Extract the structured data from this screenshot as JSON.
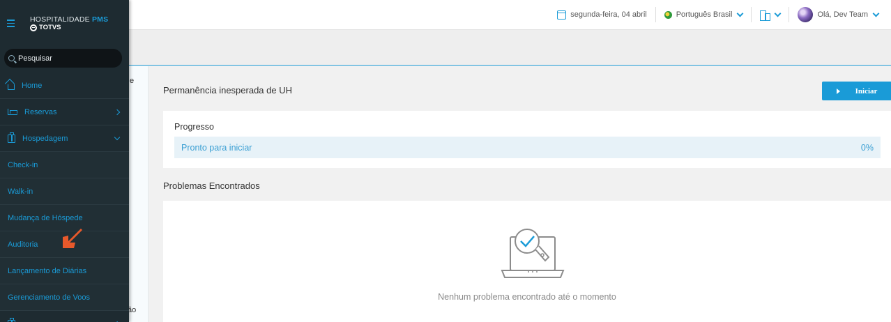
{
  "topbar": {
    "date": "segunda-feira, 04 abril",
    "language": "Português Brasil",
    "greeting": "Olá, Dev Team"
  },
  "sidebar": {
    "brand_top": "HOSPITALIDADE",
    "brand_accent": "PMS",
    "brand_bottom": "TOTVS",
    "search_placeholder": "Pesquisar",
    "items": [
      {
        "label": "Home",
        "icon": "home-icon"
      },
      {
        "label": "Reservas",
        "icon": "bed-icon"
      },
      {
        "label": "Hospedagem",
        "icon": "luggage-icon"
      }
    ],
    "subitems": [
      "Check-in",
      "Walk-in",
      "Mudança de Hóspede",
      "Auditoria",
      "Lançamento de Diárias",
      "Gerenciamento de Voos"
    ]
  },
  "strip": {
    "top_char": "e",
    "bottom_char": "ão"
  },
  "main": {
    "title": "Permanência inesperada de UH",
    "start_label": "Iniciar",
    "progress_label": "Progresso",
    "progress_status": "Pronto para iniciar",
    "progress_percent": "0%",
    "progress_value": 0,
    "problems_title": "Problemas Encontrados",
    "empty_message": "Nenhum problema encontrado até o momento"
  },
  "colors": {
    "accent": "#1a9bd7",
    "sidebar_bg": "#1e2b31",
    "pointer": "#e8592b"
  }
}
